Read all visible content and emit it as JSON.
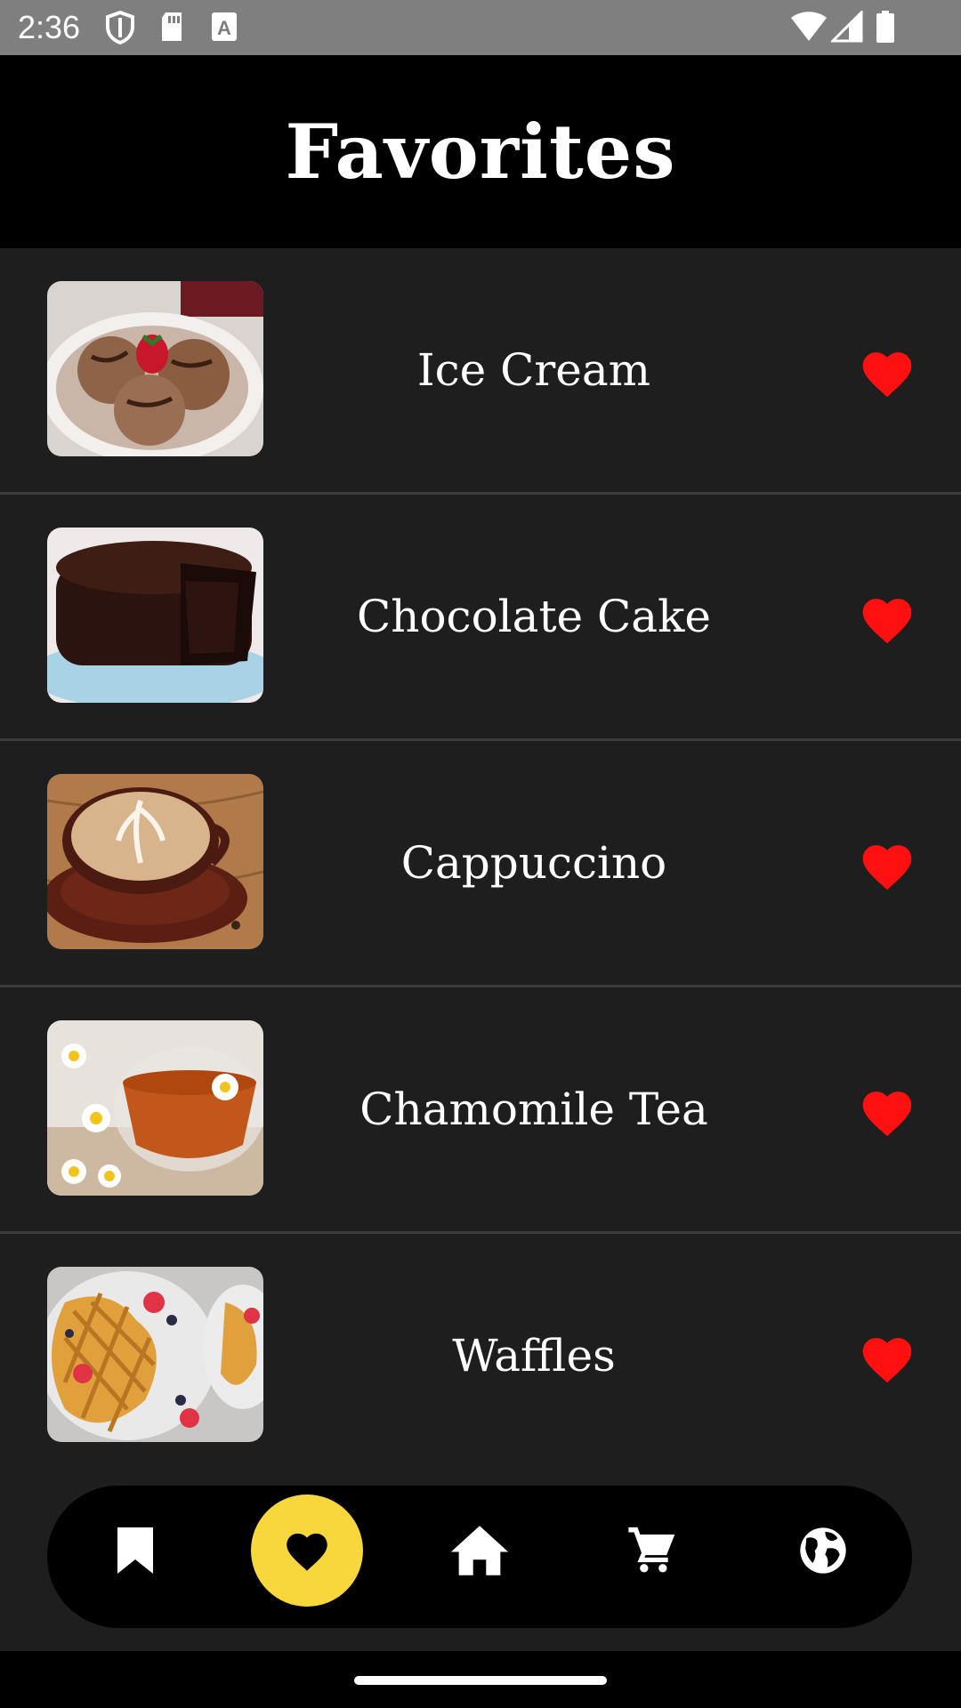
{
  "status_bar": {
    "time": "2:36"
  },
  "header": {
    "title": "Favorites"
  },
  "items": [
    {
      "name": "Ice Cream",
      "favorited": true
    },
    {
      "name": "Chocolate Cake",
      "favorited": true
    },
    {
      "name": "Cappuccino",
      "favorited": true
    },
    {
      "name": "Chamomile Tea",
      "favorited": true
    },
    {
      "name": "Waffles",
      "favorited": true
    }
  ],
  "nav": {
    "items": [
      {
        "icon": "bookmark-icon",
        "active": false
      },
      {
        "icon": "heart-icon",
        "active": true
      },
      {
        "icon": "home-icon",
        "active": false
      },
      {
        "icon": "cart-icon",
        "active": false
      },
      {
        "icon": "globe-icon",
        "active": false
      }
    ]
  },
  "colors": {
    "background": "#1e1e1f",
    "header": "#000000",
    "accent": "#f7d73c",
    "heart": "#ff1010",
    "divider": "#3c3c3e"
  }
}
